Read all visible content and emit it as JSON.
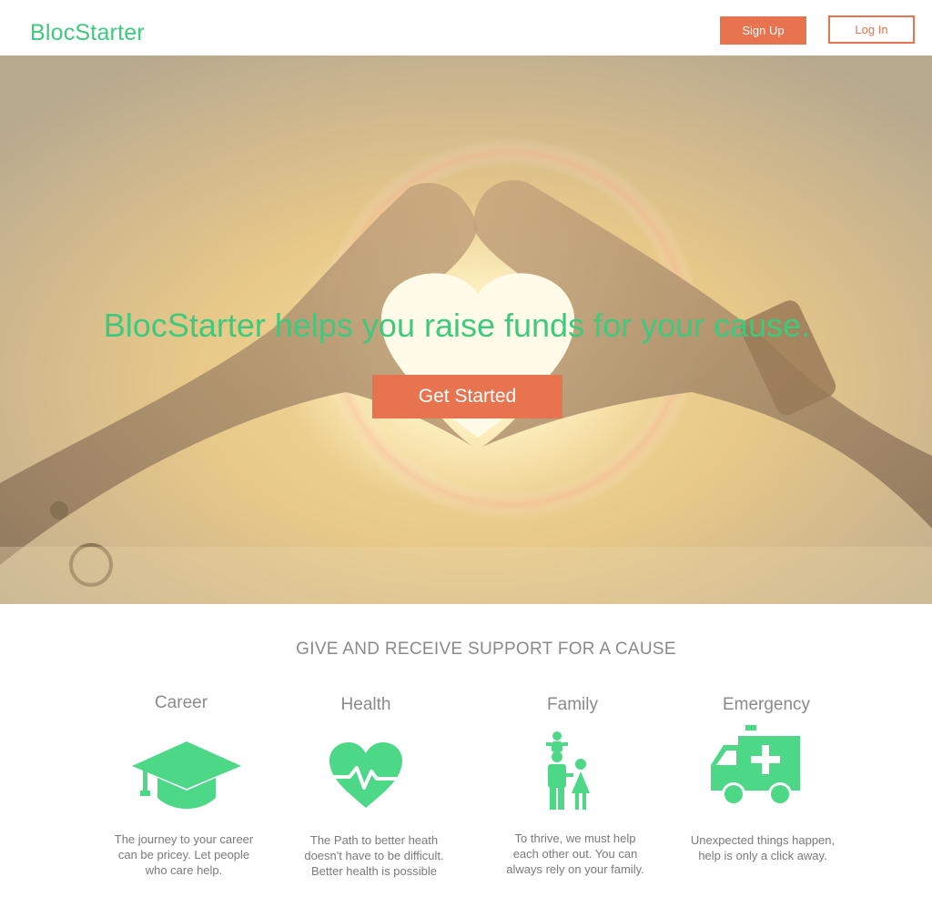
{
  "header": {
    "brand": "BlocStarter",
    "signup_label": "Sign Up",
    "login_label": "Log In"
  },
  "hero": {
    "title": "BlocStarter helps you raise funds for your cause.",
    "cta_label": "Get Started"
  },
  "features": {
    "title": "GIVE AND RECEIVE SUPPORT FOR A CAUSE",
    "items": [
      {
        "title": "Career",
        "icon": "graduation-cap-icon",
        "desc": [
          "The journey to your career",
          "can be pricey. Let people",
          "who care help."
        ]
      },
      {
        "title": "Health",
        "icon": "heart-pulse-icon",
        "desc": [
          "The Path to better heath",
          "doesn't have to be difficult.",
          "Better health is possible"
        ]
      },
      {
        "title": "Family",
        "icon": "family-icon",
        "desc": [
          "To thrive, we must help",
          "each other out. You can",
          "always rely on your family."
        ]
      },
      {
        "title": "Emergency",
        "icon": "ambulance-icon",
        "desc": [
          "Unexpected things happen,",
          "help is only a click away."
        ]
      }
    ]
  },
  "colors": {
    "brand_green": "#3fc97d",
    "accent_orange": "#e8734f",
    "icon_green": "#4dd888"
  }
}
